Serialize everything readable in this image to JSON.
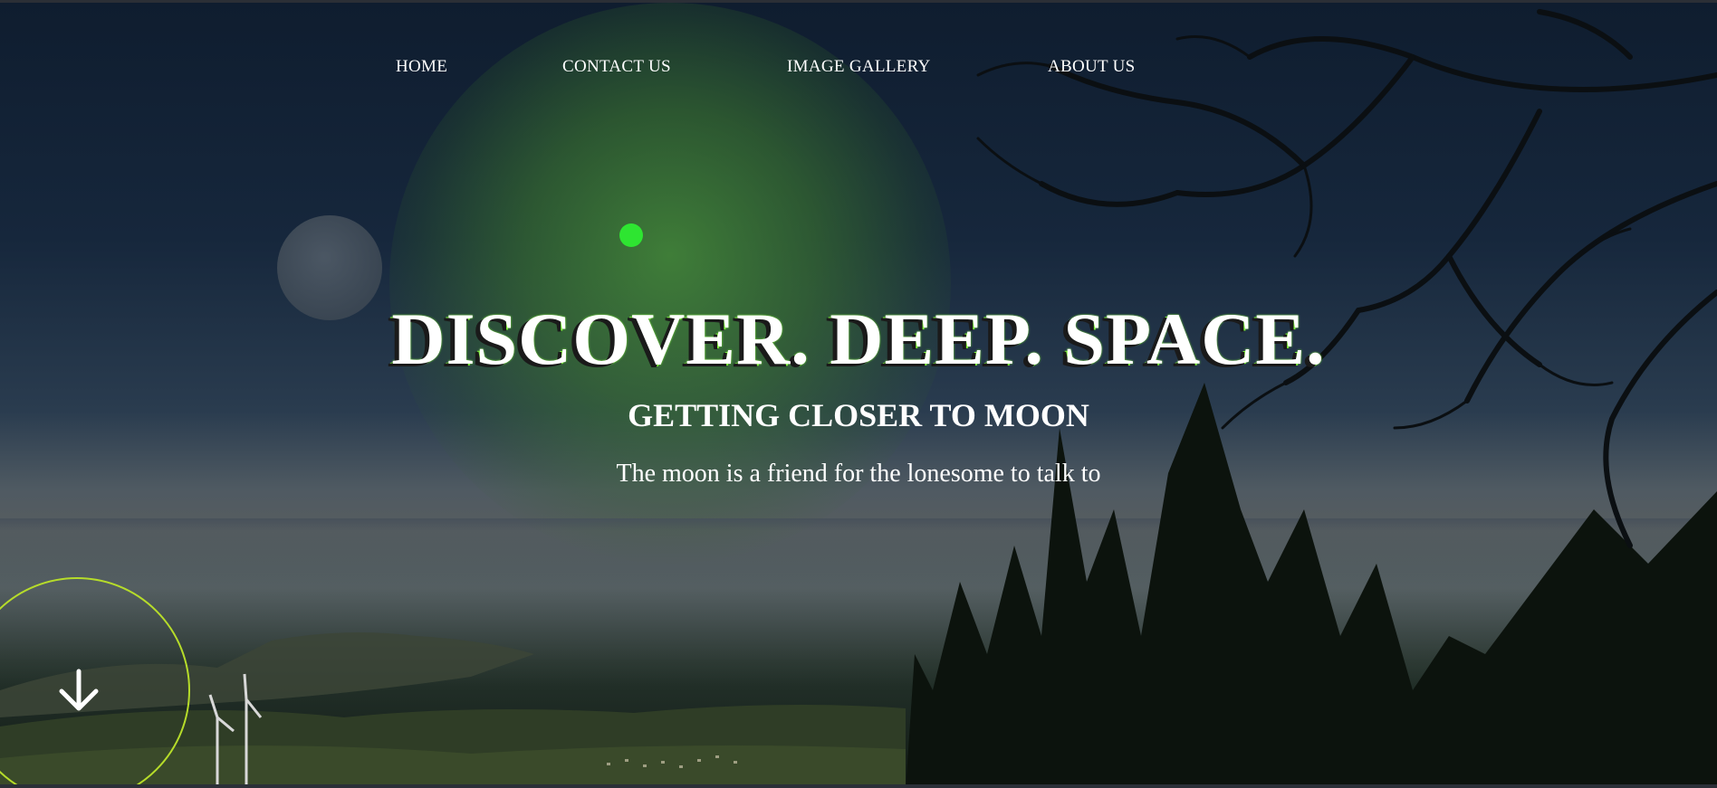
{
  "nav": {
    "items": [
      {
        "label": "HOME"
      },
      {
        "label": "CONTACT US"
      },
      {
        "label": "IMAGE GALLERY"
      },
      {
        "label": "ABOUT US"
      }
    ]
  },
  "hero": {
    "headline": "DISCOVER. DEEP. SPACE.",
    "subtitle": "GETTING CLOSER TO MOON",
    "tagline": "The moon is a friend for the lonesome to talk to"
  },
  "scroll_button": {
    "icon": "arrow-down-icon"
  },
  "colors": {
    "accent_green": "#2ee531",
    "ring_yellow_green": "#b6dc2a",
    "text": "#ffffff"
  }
}
